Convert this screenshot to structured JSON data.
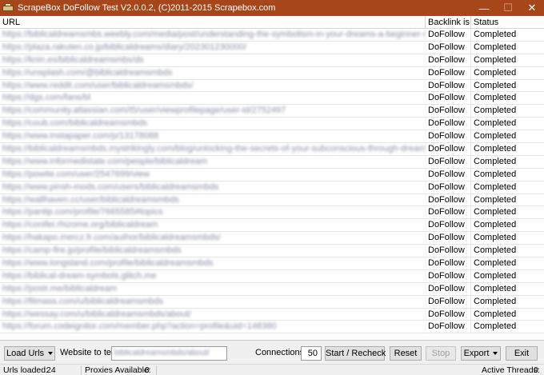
{
  "window": {
    "title": "ScrapeBox DoFollow Test V2.0.0.2, (C)2011-2015 Scrapebox.com",
    "minimize_glyph": "—",
    "maximize_glyph": "☐",
    "close_glyph": "✕"
  },
  "grid": {
    "columns": [
      "URL",
      "Backlink is",
      "Status"
    ],
    "rows": [
      {
        "url": "https://biblicaldreamsmbs.weebly.com/media/post/understanding-the-symbolism-in-your-dreams-a-beginner-s-guide",
        "backlink": "DoFollow",
        "status": "Completed"
      },
      {
        "url": "https://plaza.rakuten.co.jp/biblicaldreams/diary/202301230000/",
        "backlink": "DoFollow",
        "status": "Completed"
      },
      {
        "url": "https://knin.es/biblicaldreamsmbs/ds",
        "backlink": "DoFollow",
        "status": "Completed"
      },
      {
        "url": "https://unsplash.com/@biblicaldreamsmbds",
        "backlink": "DoFollow",
        "status": "Completed"
      },
      {
        "url": "https://www.reddit.com/user/biblicaldreamsmbds/",
        "backlink": "DoFollow",
        "status": "Completed"
      },
      {
        "url": "https://dgs.com/fans/bl",
        "backlink": "DoFollow",
        "status": "Completed"
      },
      {
        "url": "https://community.atlassian.com/t5/user/viewprofilepage/user-id/2752497",
        "backlink": "DoFollow",
        "status": "Completed"
      },
      {
        "url": "https://coub.com/biblicaldreamsmbds",
        "backlink": "DoFollow",
        "status": "Completed"
      },
      {
        "url": "https://www.instapaper.com/p/13178088",
        "backlink": "DoFollow",
        "status": "Completed"
      },
      {
        "url": "https://biblicaldreamsmbds.mystrikingly.com/blog/unlocking-the-secrets-of-your-subconscious-through-dream-interpretation",
        "backlink": "DoFollow",
        "status": "Completed"
      },
      {
        "url": "https://www.informedistate.com/people/biblicaldream",
        "backlink": "DoFollow",
        "status": "Completed"
      },
      {
        "url": "https://powite.com/user/2547699/view",
        "backlink": "DoFollow",
        "status": "Completed"
      },
      {
        "url": "https://www.pinsh-mods.com/users/biblicaldreamsmbds",
        "backlink": "DoFollow",
        "status": "Completed"
      },
      {
        "url": "https://wallhaven.cc/user/biblicaldreamsmbds",
        "backlink": "DoFollow",
        "status": "Completed"
      },
      {
        "url": "https://pantip.com/profile/7665585#topics",
        "backlink": "DoFollow",
        "status": "Completed"
      },
      {
        "url": "https://conifer.rhizome.org/biblicaldream",
        "backlink": "DoFollow",
        "status": "Completed"
      },
      {
        "url": "https://hakapo.mercz.fr.com/author/biblicaldreamsmbds/",
        "backlink": "DoFollow",
        "status": "Completed"
      },
      {
        "url": "https://camp-fire.jp/profile/biblicaldreamsmbds",
        "backlink": "DoFollow",
        "status": "Completed"
      },
      {
        "url": "https://www.longsland.com/profile/biblicaldreamsmbds",
        "backlink": "DoFollow",
        "status": "Completed"
      },
      {
        "url": "https://biblical-dream-symbols.glitch.me",
        "backlink": "DoFollow",
        "status": "Completed"
      },
      {
        "url": "https://postr.me/biblicaldream",
        "backlink": "DoFollow",
        "status": "Completed"
      },
      {
        "url": "https://fitmass.com/u/biblicaldreamsmbds",
        "backlink": "DoFollow",
        "status": "Completed"
      },
      {
        "url": "https://wessay.com/u/biblicaldreamsmbds/about/",
        "backlink": "DoFollow",
        "status": "Completed"
      },
      {
        "url": "https://forum.codeignitor.com/member.php?action=profile&uid=148380",
        "backlink": "DoFollow",
        "status": "Completed"
      }
    ]
  },
  "toolbar": {
    "load_urls_label": "Load Urls",
    "website_label": "Website to test:",
    "website_value": "biblicaldreamsmbds/about/",
    "connections_label": "Connections:",
    "connections_value": "50",
    "start_label": "Start / Recheck",
    "reset_label": "Reset",
    "stop_label": "Stop",
    "export_label": "Export",
    "exit_label": "Exit"
  },
  "status": {
    "urls_loaded_label": "Urls loaded:",
    "urls_loaded_value": "24",
    "proxies_label": "Proxies Available:",
    "proxies_value": "0",
    "threads_label": "Active Threads:",
    "threads_value": "0"
  },
  "colors": {
    "titlebar": "#a8461b",
    "grid_bg": "#ffffff",
    "chrome_bg": "#f0f0f0"
  }
}
